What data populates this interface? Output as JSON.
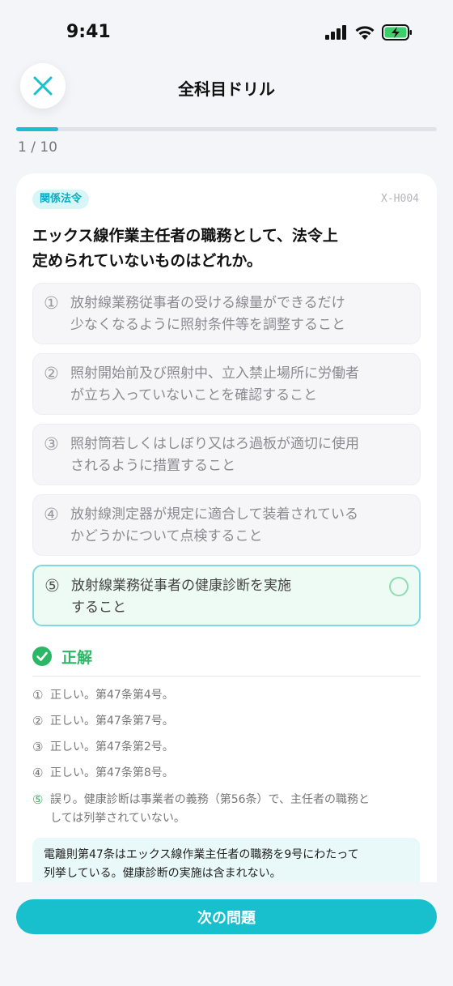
{
  "status": {
    "time": "9:41"
  },
  "header": {
    "title": "全科目ドリル",
    "close_icon": "close-icon"
  },
  "progress": {
    "text": "1 / 10",
    "fraction": 0.1
  },
  "question": {
    "category": "関係法令",
    "id": "X-H004",
    "text_line1": "エックス線作業主任者の職務として、法令上",
    "text_line2": "定められていないものはどれか。",
    "options": [
      {
        "num": "①",
        "line1": "放射線業務従事者の受ける線量ができるだけ",
        "line2": "少なくなるように照射条件等を調整すること"
      },
      {
        "num": "②",
        "line1": "照射開始前及び照射中、立入禁止場所に労働者",
        "line2": "が立ち入っていないことを確認すること"
      },
      {
        "num": "③",
        "line1": "照射筒若しくはしぼり又はろ過板が適切に使用",
        "line2": "されるように措置すること"
      },
      {
        "num": "④",
        "line1": "放射線測定器が規定に適合して装着されている",
        "line2": "かどうかについて点検すること"
      },
      {
        "num": "⑤",
        "line1": "放射線業務従事者の健康診断を実施",
        "line2": "すること"
      }
    ]
  },
  "result": {
    "label": "正解",
    "explanations": [
      {
        "num": "①",
        "text": "正しい。第47条第4号。"
      },
      {
        "num": "②",
        "text": "正しい。第47条第7号。"
      },
      {
        "num": "③",
        "text": "正しい。第47条第2号。"
      },
      {
        "num": "④",
        "text": "正しい。第47条第8号。"
      },
      {
        "num": "⑤",
        "line1": "誤り。健康診断は事業者の義務（第56条）で、主任者の職務と",
        "line2": "しては列挙されていない。"
      }
    ],
    "note_line1": "電離則第47条はエックス線作業主任者の職務を9号にわたって",
    "note_line2": "列挙している。健康診断の実施は含まれない。"
  },
  "footer": {
    "next_label": "次の問題"
  },
  "colors": {
    "accent": "#17c0cc",
    "correct": "#2bb866"
  }
}
